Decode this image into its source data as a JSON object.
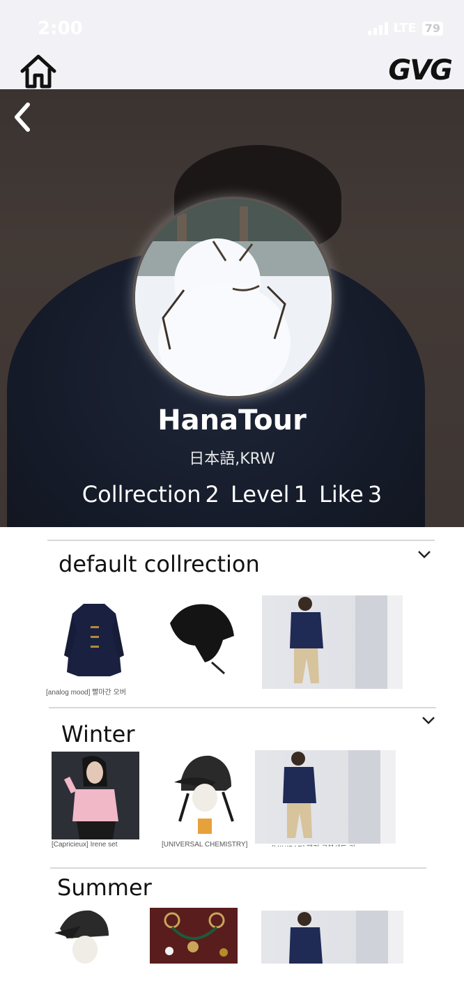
{
  "status_bar": {
    "time": "2:00",
    "network": "LTE",
    "battery": "79"
  },
  "header": {
    "logo": "GVG"
  },
  "profile": {
    "name": "HanaTour",
    "locale": "日本語,KRW",
    "stats": {
      "collection_label": "Collrection",
      "collection_count": "2",
      "level_label": "Level",
      "level_value": "1",
      "like_label": "Like",
      "like_count": "3"
    }
  },
  "collections": [
    {
      "title": "default collrection",
      "items": [
        {
          "caption": "[analog mood] 빨마간 오버"
        },
        {
          "caption": ""
        },
        {
          "caption": ""
        }
      ]
    },
    {
      "title": "Winter",
      "items": [
        {
          "caption": "[Capricieux] Irene set"
        },
        {
          "caption": "[UNIVERSAL CHEMISTRY]"
        },
        {
          "caption": "[MINIBAR] 헨링 공복세트 기"
        }
      ]
    },
    {
      "title": "Summer",
      "items": [
        {
          "caption": ""
        },
        {
          "caption": ""
        },
        {
          "caption": ""
        }
      ]
    }
  ],
  "colors": {
    "hero_background": "#3e3633",
    "hoodie_navy": "#1b2233",
    "divider": "#d8d8d8"
  },
  "icons": {
    "home": "home-icon",
    "back": "back-arrow-icon",
    "expand": "chevron-down-icon"
  }
}
